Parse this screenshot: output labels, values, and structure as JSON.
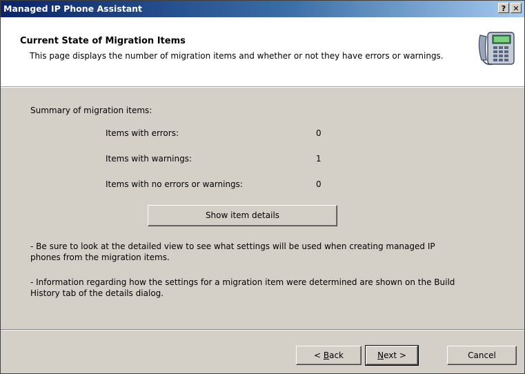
{
  "window": {
    "title": "Managed IP Phone Assistant",
    "help_label": "?",
    "close_label": "✕"
  },
  "header": {
    "title": "Current State of Migration Items",
    "description": "This page displays the number of migration items and whether or not they have errors or warnings."
  },
  "summary": {
    "label": "Summary of migration items:",
    "rows": [
      {
        "label": "Items with errors:",
        "value": "0"
      },
      {
        "label": "Items with warnings:",
        "value": "1"
      },
      {
        "label": "Items with no errors or warnings:",
        "value": "0"
      }
    ],
    "details_button": "Show item details"
  },
  "notes": [
    "- Be sure to look at the detailed view to see what settings will be used when creating managed IP phones from the migration items.",
    "- Information regarding how the settings for a migration item were determined are shown on the Build History tab of the details dialog."
  ],
  "footer": {
    "back_prefix": "< ",
    "back_accel": "B",
    "back_rest": "ack",
    "next_accel": "N",
    "next_rest": "ext >",
    "cancel": "Cancel"
  },
  "icons": {
    "phone": "phone-icon",
    "help": "help-icon",
    "close": "close-icon"
  }
}
